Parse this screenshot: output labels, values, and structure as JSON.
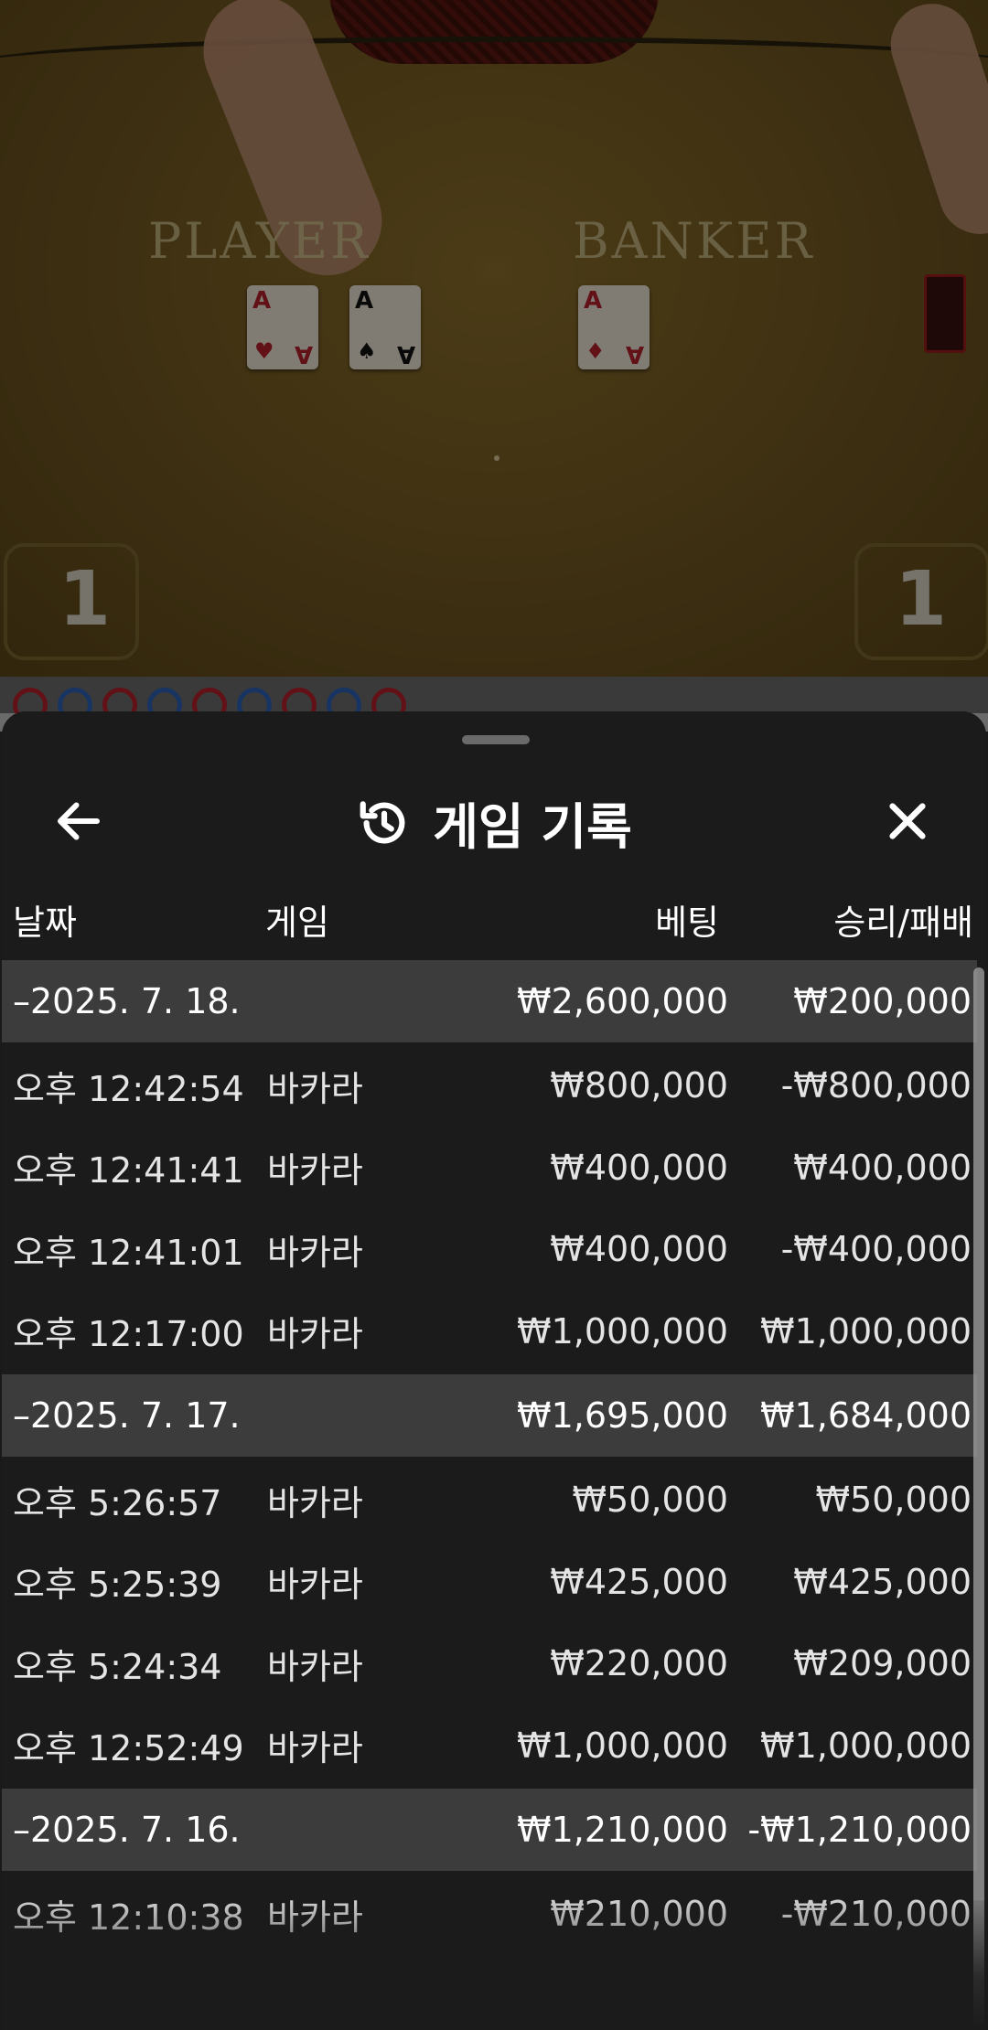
{
  "video": {
    "player_label": "PLAYER",
    "banker_label": "BANKER",
    "player_score": "1",
    "banker_score": "1",
    "cards": [
      {
        "rank": "A",
        "suit": "♥",
        "color": "red"
      },
      {
        "rank": "A",
        "suit": "♠",
        "color": "black"
      },
      {
        "rank": "A",
        "suit": "♦",
        "color": "red"
      }
    ],
    "road": [
      "red",
      "blue",
      "red",
      "blue",
      "red",
      "blue",
      "red",
      "blue",
      "red"
    ]
  },
  "sheet": {
    "title": "게임 기록",
    "back_icon": "arrow-left-icon",
    "history_icon": "history-icon",
    "close_icon": "close-icon",
    "columns": {
      "date": "날짜",
      "game": "게임",
      "bet": "베팅",
      "win_loss": "승리/패배"
    },
    "groups": [
      {
        "date": "–2025. 7. 18.",
        "bet_total": "₩2,600,000",
        "win_total": "₩200,000",
        "rows": [
          {
            "time": "오후 12:42:54",
            "game": "바카라",
            "bet": "₩800,000",
            "win": "-₩800,000"
          },
          {
            "time": "오후 12:41:41",
            "game": "바카라",
            "bet": "₩400,000",
            "win": "₩400,000"
          },
          {
            "time": "오후 12:41:01",
            "game": "바카라",
            "bet": "₩400,000",
            "win": "-₩400,000"
          },
          {
            "time": "오후 12:17:00",
            "game": "바카라",
            "bet": "₩1,000,000",
            "win": "₩1,000,000"
          }
        ]
      },
      {
        "date": "–2025. 7. 17.",
        "bet_total": "₩1,695,000",
        "win_total": "₩1,684,000",
        "rows": [
          {
            "time": "오후 5:26:57",
            "game": "바카라",
            "bet": "₩50,000",
            "win": "₩50,000"
          },
          {
            "time": "오후 5:25:39",
            "game": "바카라",
            "bet": "₩425,000",
            "win": "₩425,000"
          },
          {
            "time": "오후 5:24:34",
            "game": "바카라",
            "bet": "₩220,000",
            "win": "₩209,000"
          },
          {
            "time": "오후 12:52:49",
            "game": "바카라",
            "bet": "₩1,000,000",
            "win": "₩1,000,000"
          }
        ]
      },
      {
        "date": "–2025. 7. 16.",
        "bet_total": "₩1,210,000",
        "win_total": "-₩1,210,000",
        "rows": [
          {
            "time": "오후 12:10:38",
            "game": "바카라",
            "bet": "₩210,000",
            "win": "-₩210,000"
          }
        ]
      }
    ]
  },
  "colors": {
    "red": "#b3202a",
    "blue": "#2a5fb3",
    "sheet_bg": "#1b1b1b",
    "group_bg": "#3c3c3c"
  }
}
